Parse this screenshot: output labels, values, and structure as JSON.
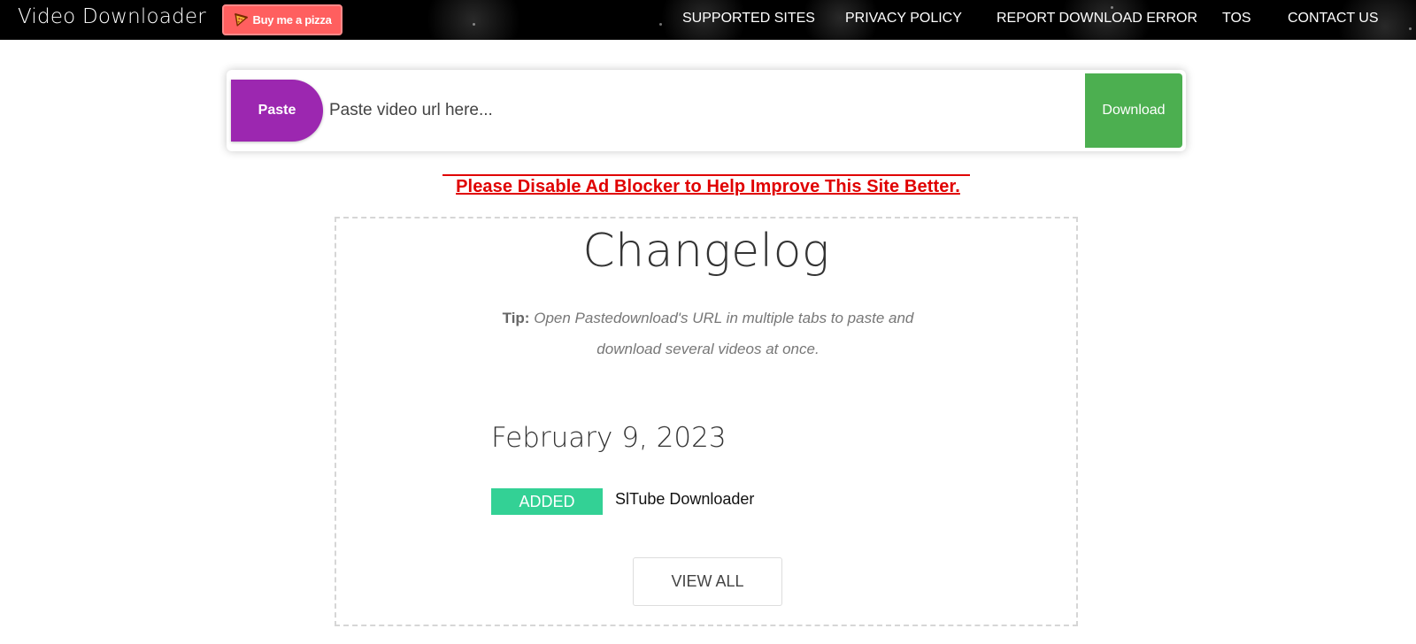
{
  "header": {
    "brand": "Video Downloader",
    "pizza_button": {
      "label": "Buy me a pizza",
      "icon": "pizza-icon",
      "color": "#ff5f5f"
    },
    "nav": [
      {
        "label": "SUPPORTED SITES"
      },
      {
        "label": "PRIVACY POLICY"
      },
      {
        "label": "REPORT DOWNLOAD ERROR"
      },
      {
        "label": "TOS"
      },
      {
        "label": "CONTACT US"
      }
    ]
  },
  "search": {
    "paste_label": "Paste",
    "paste_color": "#9c27b0",
    "placeholder": "Paste video url here...",
    "value": "",
    "download_label": "Download",
    "download_color": "#4caf50"
  },
  "notice": {
    "text": "Please Disable Ad Blocker to Help Improve This Site Better.",
    "color": "#e00000"
  },
  "changelog": {
    "title": "Changelog",
    "tip_label": "Tip:",
    "tip_text": "Open Pastedownload's URL in multiple tabs to paste and download several videos at once.",
    "entries": [
      {
        "date": "February 9, 2023",
        "badge": "ADDED",
        "badge_color": "#33d195",
        "text": "SlTube Downloader"
      }
    ],
    "view_all_label": "VIEW ALL"
  }
}
